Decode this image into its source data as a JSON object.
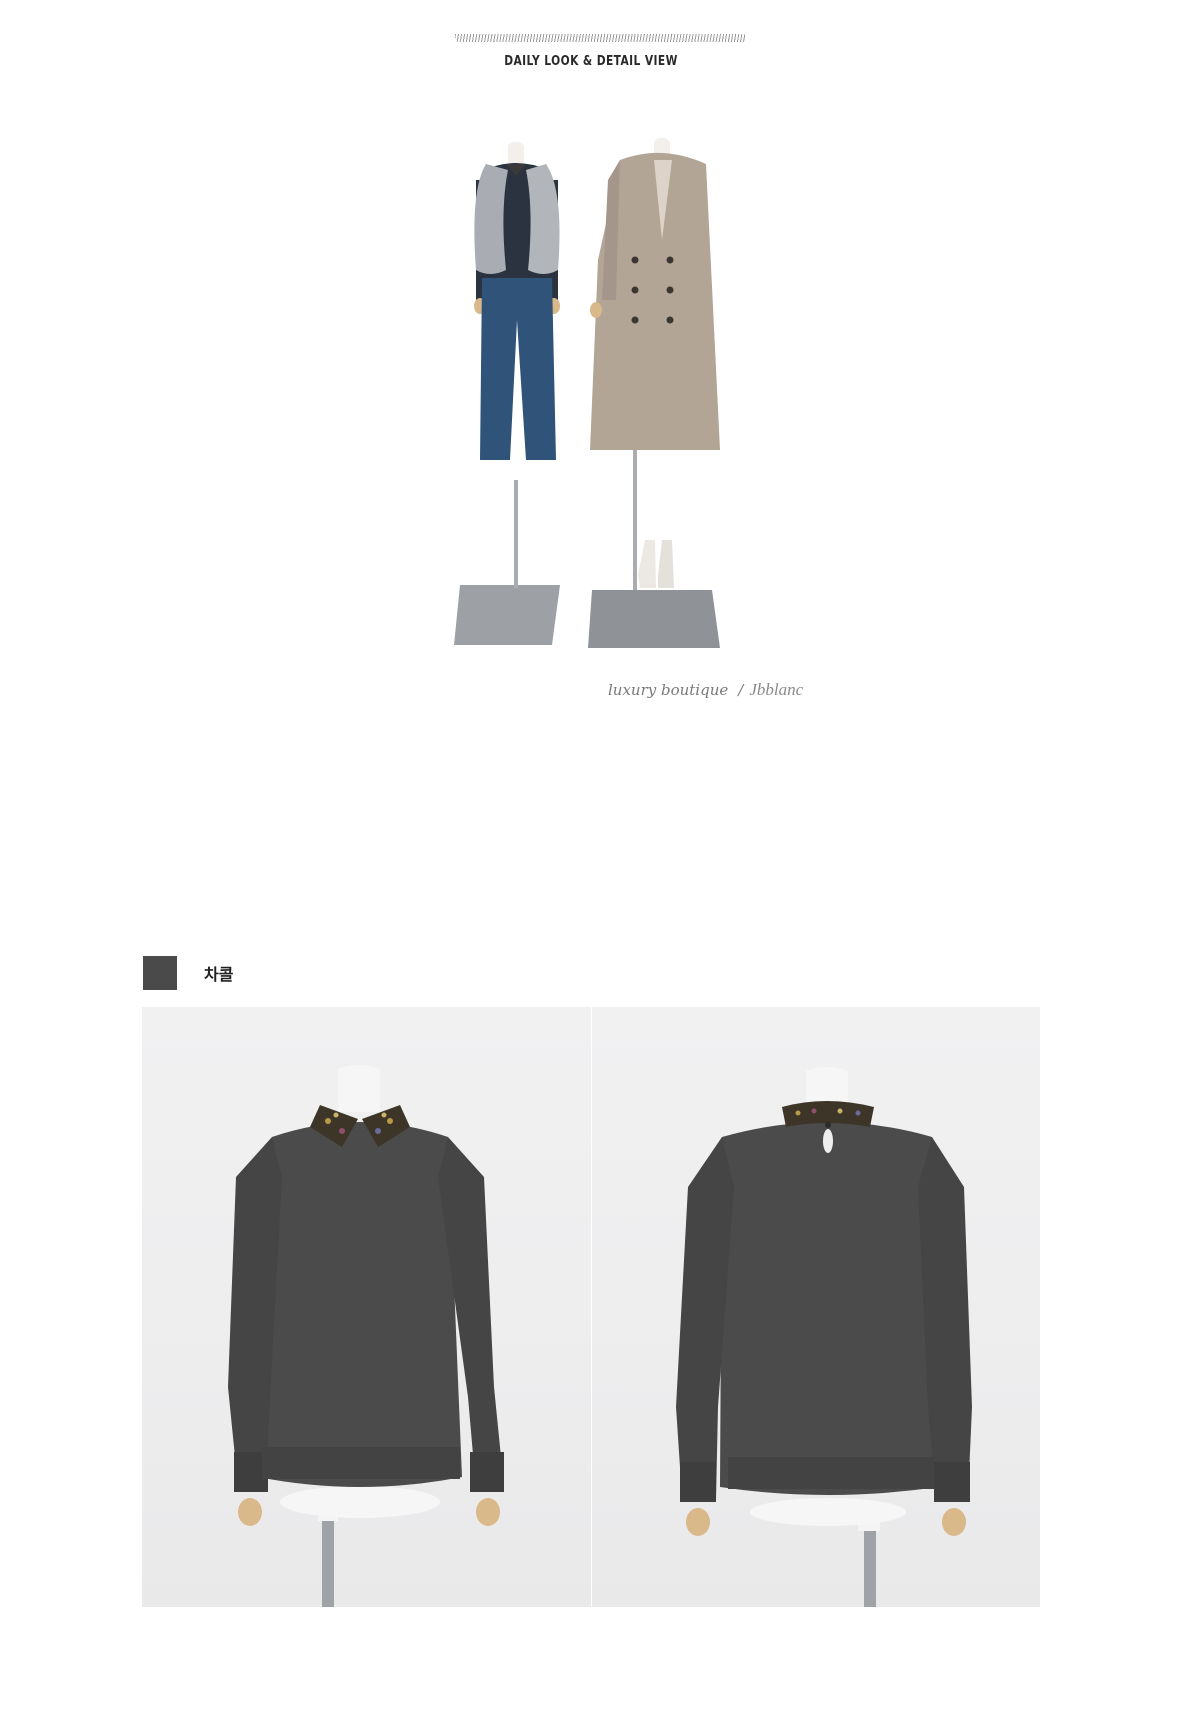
{
  "header": {
    "title": "DAILY LOOK & DETAIL VIEW"
  },
  "look": {
    "tagline": "luxury boutique",
    "separator": "/",
    "signature": "Jbblanc"
  },
  "color_option": {
    "swatch_color": "#4a4a4a",
    "label": "차콜"
  },
  "colors": {
    "sweater": "#4b4b4c",
    "coat": "#b3a596",
    "denim": "#2f5379",
    "fur": "#a9adb3"
  }
}
